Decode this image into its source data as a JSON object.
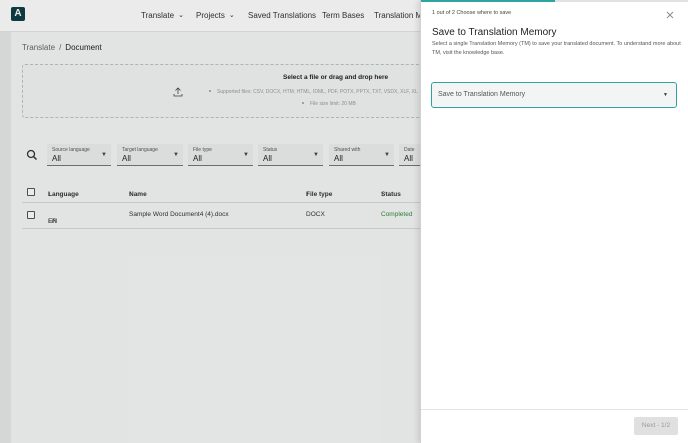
{
  "nav": {
    "logo": "A",
    "items": [
      {
        "label": "Translate",
        "has_dropdown": true
      },
      {
        "label": "Projects",
        "has_dropdown": true
      },
      {
        "label": "Saved Translations",
        "has_dropdown": false
      },
      {
        "label": "Term Bases",
        "has_dropdown": false
      },
      {
        "label": "Translation Me",
        "has_dropdown": false
      }
    ]
  },
  "breadcrumb": {
    "parent": "Translate",
    "separator": "/",
    "current": "Document"
  },
  "upload": {
    "title": "Select a file or drag and drop here",
    "supported": "Supported files: CSV, DOCX, HTM, HTML, IDML, PDF, POTX, PPTX, TXT, VSDX, XLF, XL",
    "size_limit": "File size limit: 20 MB"
  },
  "filters": [
    {
      "label": "Source language",
      "value": "All"
    },
    {
      "label": "Target language",
      "value": "All"
    },
    {
      "label": "File type",
      "value": "All"
    },
    {
      "label": "Status",
      "value": "All"
    },
    {
      "label": "Shared with",
      "value": "All"
    },
    {
      "label": "Date",
      "value": "All"
    }
  ],
  "table": {
    "columns": [
      "Language",
      "Name",
      "File type",
      "Status"
    ],
    "rows": [
      {
        "source": "EN",
        "target": "FR",
        "arrow": "→",
        "name": "Sample Word Document4 (4).docx",
        "file_type": "DOCX",
        "status": "Completed"
      }
    ]
  },
  "panel": {
    "step": "1 out of 2 Choose where to save",
    "progress": 0.5,
    "title": "Save to Translation Memory",
    "description": "Select a single Translation Memory (TM) to save your translated document. To understand more about TM, visit the knowledge base.",
    "select_value": "Save to Translation Memory",
    "next_label": "Next - 1/2"
  },
  "icons": {
    "close": "close-icon",
    "search": "search-icon",
    "upload": "upload-icon",
    "sort": "sort-arrow-up-icon"
  },
  "colors": {
    "accent": "#2fa3a3",
    "brand": "#0f3f45",
    "status_completed": "#2e8b3a"
  }
}
